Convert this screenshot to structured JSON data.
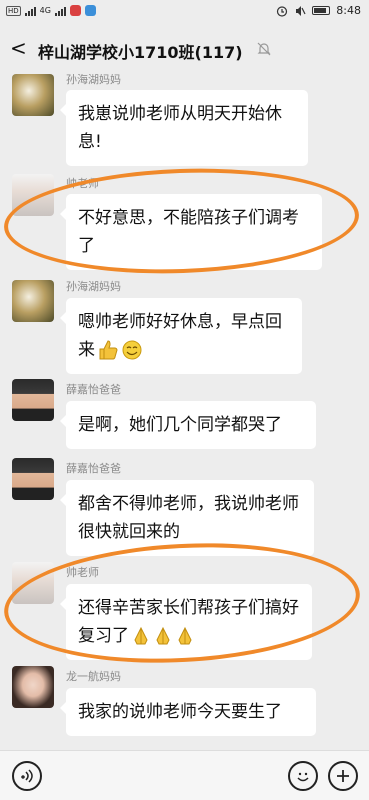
{
  "status_bar": {
    "time": "8:48",
    "left_glyphs": "HD",
    "net_label": "4G"
  },
  "header": {
    "back_glyph": "<",
    "title": "梓山湖学校小1710班(117)"
  },
  "messages": [
    {
      "sender": "孙海湖妈妈",
      "text": "我崽说帅老师从明天开始休息!"
    },
    {
      "sender": "帅老师",
      "text": "不好意思，不能陪孩子们调考了",
      "highlighted": true
    },
    {
      "sender": "孙海湖妈妈",
      "text": "嗯帅老师好好休息，早点回来",
      "emoji": [
        "thumbs-up",
        "smile"
      ]
    },
    {
      "sender": "薛嘉怡爸爸",
      "text": "是啊，她们几个同学都哭了"
    },
    {
      "sender": "薛嘉怡爸爸",
      "text": "都舍不得帅老师，我说帅老师很快就回来的"
    },
    {
      "sender": "帅老师",
      "text": "还得辛苦家长们帮孩子们搞好复习了",
      "emoji": [
        "pray",
        "pray",
        "pray"
      ],
      "highlighted": true
    },
    {
      "sender": "龙一航妈妈",
      "text": "我家的说帅老师今天要生了"
    }
  ],
  "highlight_color": "#f0892a",
  "input_bar": {
    "voice_icon": "voice-icon",
    "emoji_icon": "emoji-icon",
    "plus_icon": "plus-icon"
  }
}
